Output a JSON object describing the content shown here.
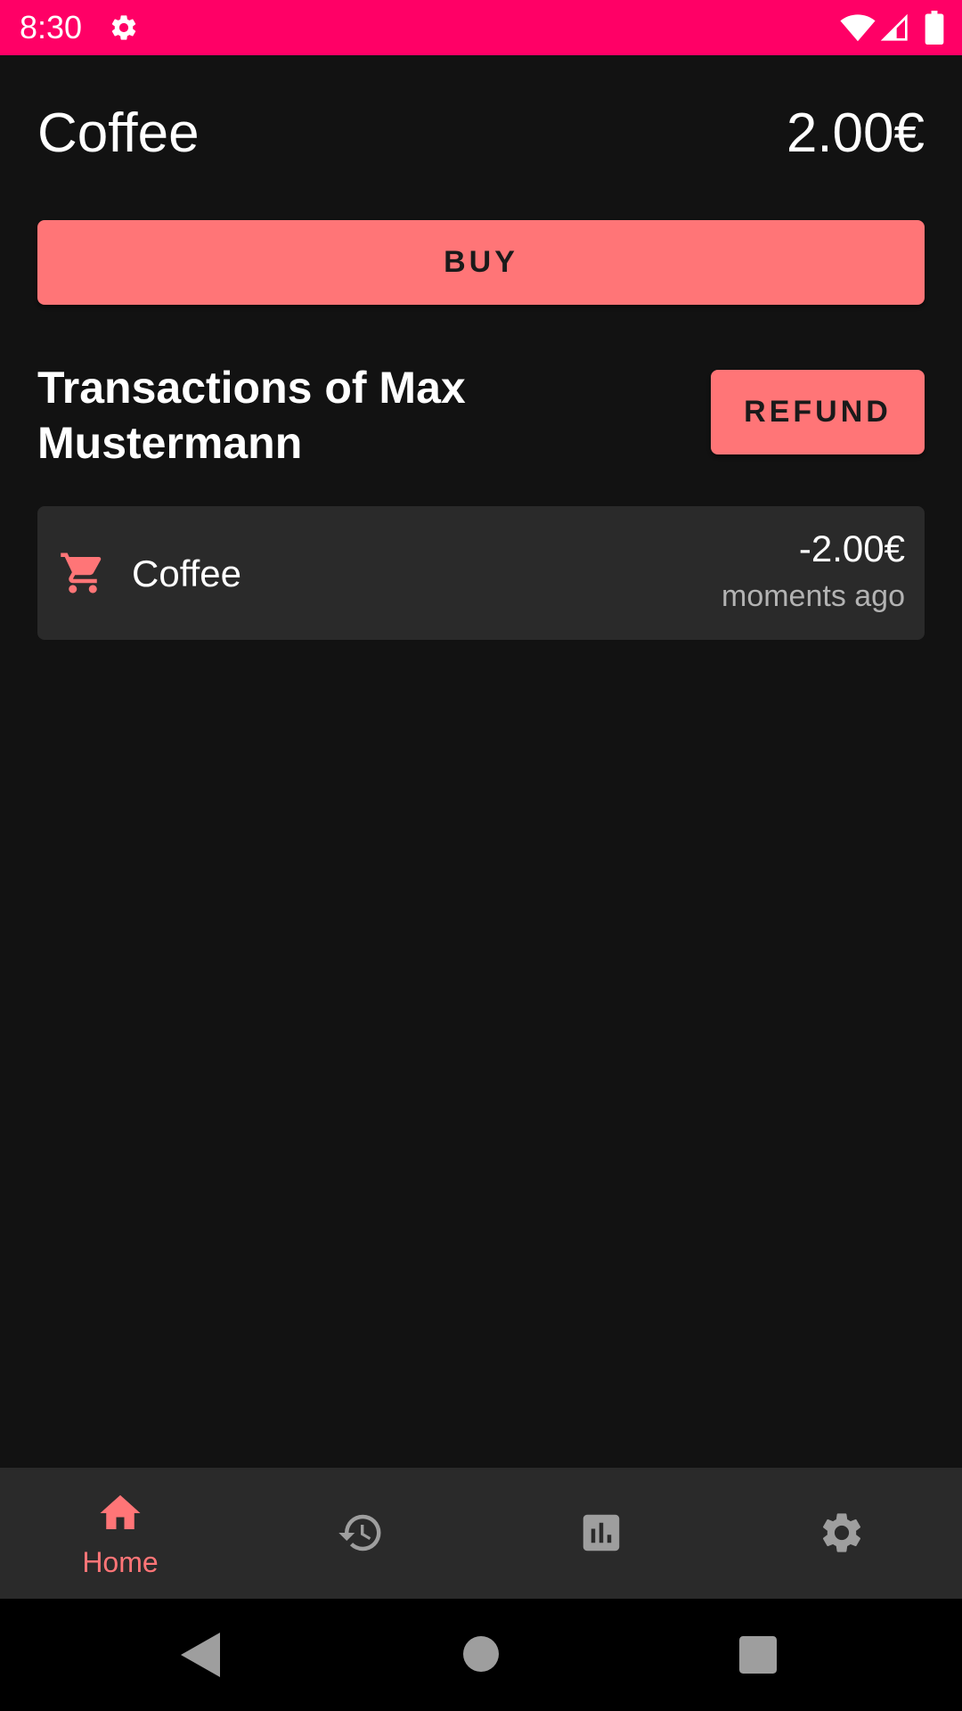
{
  "status_bar": {
    "time": "8:30",
    "background_color": "#ff0066",
    "icons": [
      "gear-icon",
      "wifi-icon",
      "signal-icon",
      "battery-icon"
    ]
  },
  "product": {
    "name": "Coffee",
    "price": "2.00€"
  },
  "actions": {
    "buy_label": "BUY",
    "refund_label": "REFUND",
    "accent_color": "#ff7577"
  },
  "transactions": {
    "title": "Transactions of Max Mustermann",
    "items": [
      {
        "icon": "cart-icon",
        "name": "Coffee",
        "amount": "-2.00€",
        "time": "moments ago"
      }
    ]
  },
  "bottom_nav": {
    "items": [
      {
        "icon": "home-icon",
        "label": "Home",
        "selected": true
      },
      {
        "icon": "history-icon",
        "label": "",
        "selected": false
      },
      {
        "icon": "bar-chart-icon",
        "label": "",
        "selected": false
      },
      {
        "icon": "settings-icon",
        "label": "",
        "selected": false
      }
    ]
  },
  "system_nav": {
    "icons": [
      "back-icon",
      "home-circle-icon",
      "recents-icon"
    ]
  }
}
